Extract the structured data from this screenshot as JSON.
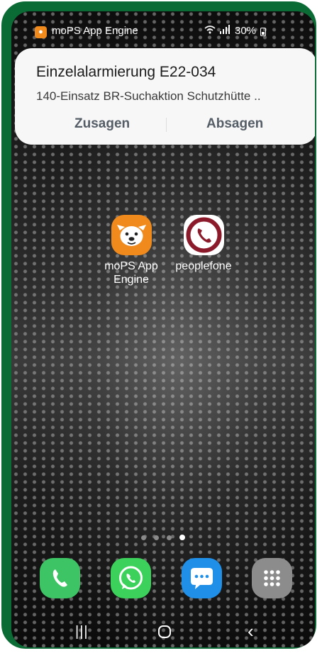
{
  "status_bar": {
    "app_name": "moPS App Engine",
    "battery": "30%"
  },
  "notification": {
    "title": "Einzelalarmierung E22-034",
    "body": "140-Einsatz BR-Suchaktion Schutzhütte ..",
    "accept_label": "Zusagen",
    "decline_label": "Absagen"
  },
  "home_apps": [
    {
      "label_line1": "moPS App",
      "label_line2": "Engine",
      "icon": "mops-dog-icon"
    },
    {
      "label_line1": "peoplefone",
      "label_line2": "",
      "icon": "peoplefone-phone-icon"
    }
  ],
  "page_indicator": {
    "pages": 4,
    "active": 4
  },
  "dock": [
    {
      "icon": "phone-icon"
    },
    {
      "icon": "whatsapp-icon"
    },
    {
      "icon": "messages-icon"
    },
    {
      "icon": "app-drawer-icon"
    }
  ],
  "colors": {
    "frame": "#0a6b34",
    "mops": "#f08a1c",
    "phone": "#3dc464",
    "whatsapp": "#3cd15a",
    "messages": "#1f8fe8"
  }
}
